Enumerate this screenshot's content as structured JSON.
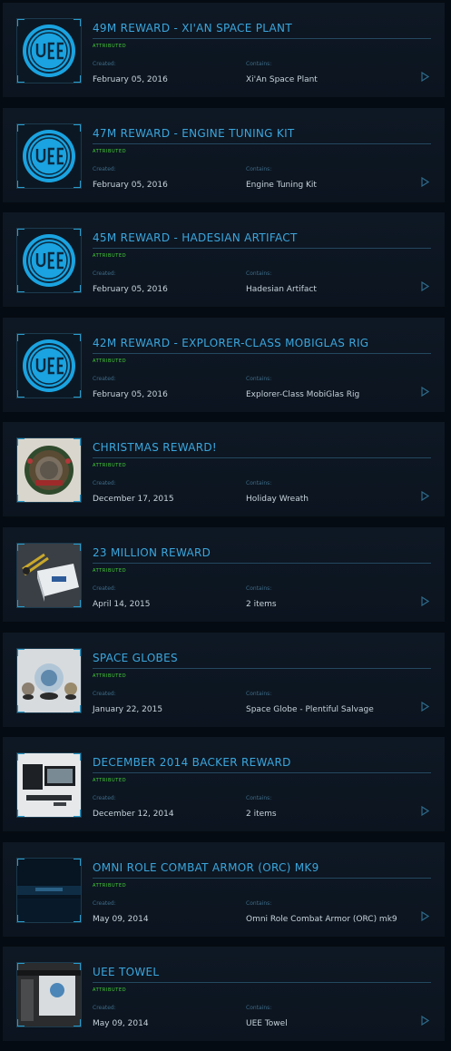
{
  "pledges": [
    {
      "title": "49M REWARD - XI'AN SPACE PLANT",
      "status": "ATTRIBUTED",
      "created_label": "Created:",
      "created": "February 05, 2016",
      "contains_label": "Contains:",
      "contains": "Xi'An Space Plant",
      "thumbnail": "uee-logo"
    },
    {
      "title": "47M REWARD - ENGINE TUNING KIT",
      "status": "ATTRIBUTED",
      "created_label": "Created:",
      "created": "February 05, 2016",
      "contains_label": "Contains:",
      "contains": "Engine Tuning Kit",
      "thumbnail": "uee-logo"
    },
    {
      "title": "45M REWARD - HADESIAN ARTIFACT",
      "status": "ATTRIBUTED",
      "created_label": "Created:",
      "created": "February 05, 2016",
      "contains_label": "Contains:",
      "contains": "Hadesian Artifact",
      "thumbnail": "uee-logo"
    },
    {
      "title": "42M REWARD - EXPLORER-CLASS MOBIGLAS RIG",
      "status": "ATTRIBUTED",
      "created_label": "Created:",
      "created": "February 05, 2016",
      "contains_label": "Contains:",
      "contains": "Explorer-Class MobiGlas Rig",
      "thumbnail": "uee-logo"
    },
    {
      "title": "CHRISTMAS REWARD!",
      "status": "ATTRIBUTED",
      "created_label": "Created:",
      "created": "December 17, 2015",
      "contains_label": "Contains:",
      "contains": "Holiday Wreath",
      "thumbnail": "wreath"
    },
    {
      "title": "23 MILLION REWARD",
      "status": "ATTRIBUTED",
      "created_label": "Created:",
      "created": "April 14, 2015",
      "contains_label": "Contains:",
      "contains": "2 items",
      "thumbnail": "box-and-tool"
    },
    {
      "title": "SPACE GLOBES",
      "status": "ATTRIBUTED",
      "created_label": "Created:",
      "created": "January 22, 2015",
      "contains_label": "Contains:",
      "contains": "Space Globe - Plentiful Salvage",
      "thumbnail": "globes"
    },
    {
      "title": "DECEMBER 2014 BACKER REWARD",
      "status": "ATTRIBUTED",
      "created_label": "Created:",
      "created": "December 12, 2014",
      "contains_label": "Contains:",
      "contains": "2 items",
      "thumbnail": "monitors"
    },
    {
      "title": "OMNI ROLE COMBAT ARMOR (ORC) MK9",
      "status": "ATTRIBUTED",
      "created_label": "Created:",
      "created": "May 09, 2014",
      "contains_label": "Contains:",
      "contains": "Omni Role Combat Armor (ORC) mk9",
      "thumbnail": "dark-scene"
    },
    {
      "title": "UEE TOWEL",
      "status": "ATTRIBUTED",
      "created_label": "Created:",
      "created": "May 09, 2014",
      "contains_label": "Contains:",
      "contains": "UEE Towel",
      "thumbnail": "towel"
    }
  ],
  "colors": {
    "accent": "#3ba6dd",
    "status": "#47d23a",
    "text": "#c7d3dc",
    "label": "#3d6b86",
    "panel": "#0e1824"
  }
}
